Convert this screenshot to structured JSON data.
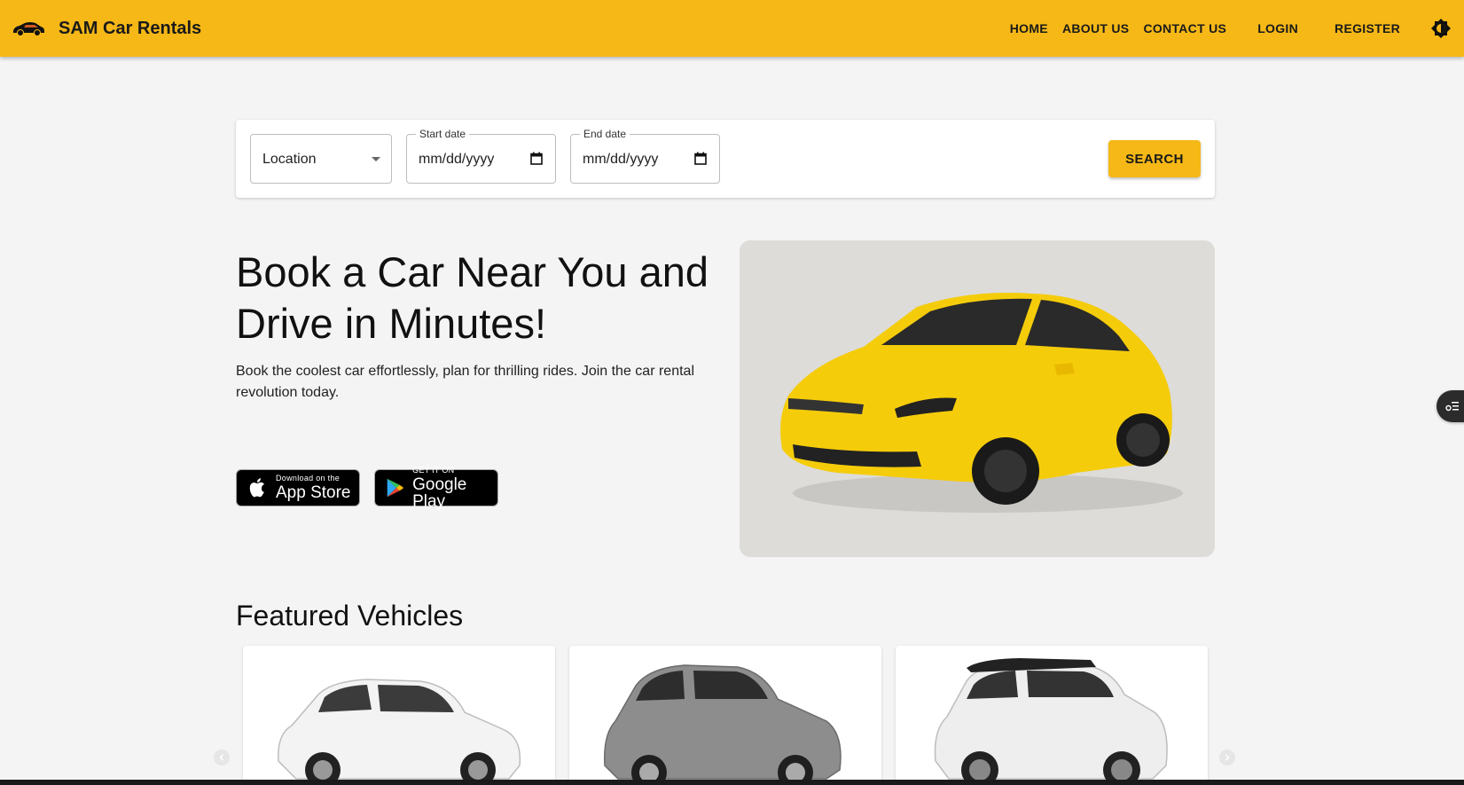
{
  "app": {
    "title": "SAM Car Rentals"
  },
  "nav": {
    "items": [
      {
        "label": "HOME"
      },
      {
        "label": "ABOUT US"
      },
      {
        "label": "CONTACT US"
      },
      {
        "label": "LOGIN"
      },
      {
        "label": "REGISTER"
      }
    ],
    "theme_icon": "brightness-icon"
  },
  "search": {
    "location_value": "Location",
    "start_label": "Start date",
    "start_value": "mm/dd/yyyy",
    "end_label": "End date",
    "end_value": "mm/dd/yyyy",
    "button_label": "SEARCH"
  },
  "hero": {
    "title": "Book a Car Near You and Drive in Minutes!",
    "subtitle": "Book the coolest car effortlessly, plan for thrilling rides. Join the car rental revolution today.",
    "app_store": {
      "small": "Download on the",
      "big": "App Store"
    },
    "google_play": {
      "small": "GET IT ON",
      "big": "Google Play"
    }
  },
  "featured": {
    "title": "Featured Vehicles",
    "vehicles": [
      {
        "color": "#f2f2f2"
      },
      {
        "color": "#8d8d8d"
      },
      {
        "color": "#eeeeee"
      }
    ]
  },
  "colors": {
    "accent": "#f6b817",
    "background": "#f4f4f4",
    "car_yellow": "#f5cc0a"
  }
}
